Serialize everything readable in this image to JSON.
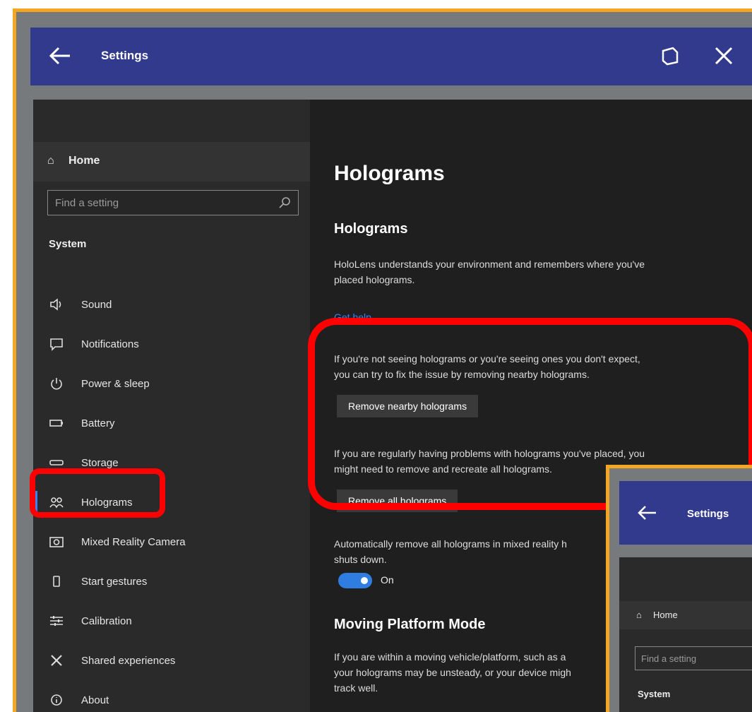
{
  "titlebar": {
    "title": "Settings",
    "back_icon": "back-arrow-icon",
    "snap_icon": "snap-window-icon",
    "close_icon": "close-icon"
  },
  "sidebar": {
    "home_label": "Home",
    "search_placeholder": "Find a setting",
    "section_label": "System",
    "items": [
      {
        "label": "Sound",
        "icon": "speaker-icon"
      },
      {
        "label": "Notifications",
        "icon": "chat-bubble-icon"
      },
      {
        "label": "Power & sleep",
        "icon": "power-icon"
      },
      {
        "label": "Battery",
        "icon": "battery-icon"
      },
      {
        "label": "Storage",
        "icon": "storage-icon"
      },
      {
        "label": "Holograms",
        "icon": "holograms-icon",
        "active": true
      },
      {
        "label": "Mixed Reality Camera",
        "icon": "camera-icon"
      },
      {
        "label": "Start gestures",
        "icon": "phone-icon"
      },
      {
        "label": "Calibration",
        "icon": "calibration-icon"
      },
      {
        "label": "Shared experiences",
        "icon": "cross-icon"
      },
      {
        "label": "About",
        "icon": "info-icon"
      }
    ]
  },
  "content": {
    "page_title": "Holograms",
    "section_title": "Holograms",
    "intro_line1": "HoloLens understands your environment and remembers where you've",
    "intro_line2": "placed holograms.",
    "help_link": "Get help",
    "nearby_text_line1": "If you're not seeing holograms or you're seeing ones you don't expect,",
    "nearby_text_line2": "you can try to fix the issue by removing nearby holograms.",
    "nearby_button": "Remove nearby holograms",
    "all_text_line1": "If you are regularly having problems with holograms you've placed, you",
    "all_text_line2": "might need to remove and recreate all holograms.",
    "all_button": "Remove all holograms",
    "auto_text_line1": "Automatically remove all holograms in mixed reality h",
    "auto_text_line2": "shuts down.",
    "toggle_label": "On",
    "moving_title": "Moving Platform Mode",
    "moving_line1": "If you are within a moving vehicle/platform, such as a",
    "moving_line2": "your holograms may be unsteady, or your device migh",
    "moving_line3": "track well."
  },
  "inset": {
    "title": "Settings",
    "home_label": "Home",
    "search_placeholder": "Find a setting",
    "section_label": "System"
  },
  "colors": {
    "titlebar": "#313a8c",
    "highlight": "#ff0000",
    "frame": "#f4a622",
    "accent": "#3b82f6"
  }
}
